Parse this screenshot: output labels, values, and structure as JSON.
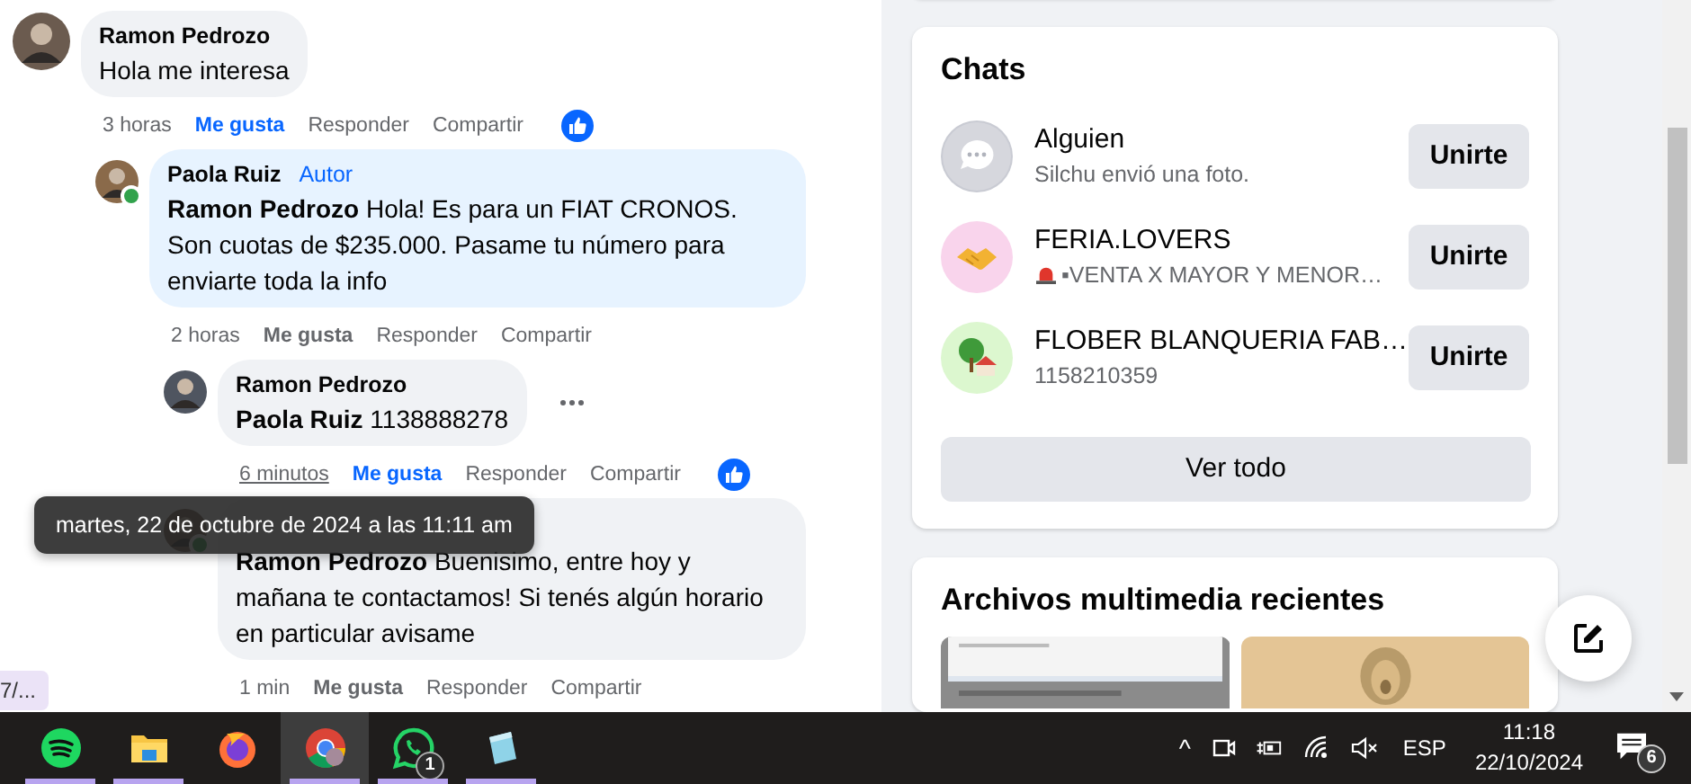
{
  "comments": [
    {
      "author": "Ramon Pedrozo",
      "text": "Hola me interesa",
      "time": "3 horas",
      "time_hovered": false,
      "like_label": "Me gusta",
      "liked": true,
      "reply_label": "Responder",
      "share_label": "Compartir",
      "reacted": true,
      "online": false,
      "menu": false,
      "children": [
        {
          "author": "Paola Ruiz",
          "badge": "Autor",
          "mention": "Ramon Pedrozo",
          "text": "Hola! Es para un FIAT CRONOS. Son cuotas de $235.000. Pasame tu número para enviarte toda la info",
          "time": "2 horas",
          "time_hovered": false,
          "like_label": "Me gusta",
          "liked": false,
          "reply_label": "Responder",
          "share_label": "Compartir",
          "reacted": false,
          "online": true,
          "menu": false,
          "children": [
            {
              "author": "Ramon Pedrozo",
              "mention": "Paola Ruiz",
              "text": "1138888278",
              "time": "6 minutos",
              "time_hovered": true,
              "like_label": "Me gusta",
              "liked": true,
              "reply_label": "Responder",
              "share_label": "Compartir",
              "reacted": true,
              "online": false,
              "menu": true
            },
            {
              "mention": "Ramon Pedrozo",
              "text": "Buenisimo, entre hoy y mañana te contactamos! Si tenés algún horario en particular avisame",
              "time": "1 min",
              "time_hovered": false,
              "like_label": "Me gusta",
              "liked": false,
              "reply_label": "Responder",
              "share_label": "Compartir",
              "reacted": false,
              "online": true,
              "menu": false
            }
          ]
        }
      ]
    }
  ],
  "tooltip": "martes, 22 de octubre de 2024 a las 11:11 am",
  "side_tag": "7/...",
  "chats": {
    "title": "Chats",
    "items": [
      {
        "name": "Alguien",
        "subtitle": "Silchu envió una foto.",
        "button": "Unirte"
      },
      {
        "name": "FERIA.LOVERS",
        "subtitle": "▪VENTA X MAYOR Y MENOR…",
        "button": "Unirte"
      },
      {
        "name": "FLOBER BLANQUERIA FAB…",
        "subtitle": "1158210359",
        "button": "Unirte"
      }
    ],
    "see_all": "Ver todo"
  },
  "media": {
    "title": "Archivos multimedia recientes"
  },
  "taskbar": {
    "apps": [
      {
        "kind": "spotify",
        "running": true,
        "selected": false
      },
      {
        "kind": "folder",
        "running": true,
        "selected": false
      },
      {
        "kind": "firefox",
        "running": false,
        "selected": false
      },
      {
        "kind": "chrome",
        "running": true,
        "selected": true
      },
      {
        "kind": "whatsapp",
        "running": true,
        "selected": false,
        "badge": "1"
      },
      {
        "kind": "notepad",
        "running": true,
        "selected": false
      }
    ],
    "chevron": "^",
    "language": "ESP",
    "time": "11:18",
    "date": "22/10/2024",
    "notifications": "6"
  }
}
